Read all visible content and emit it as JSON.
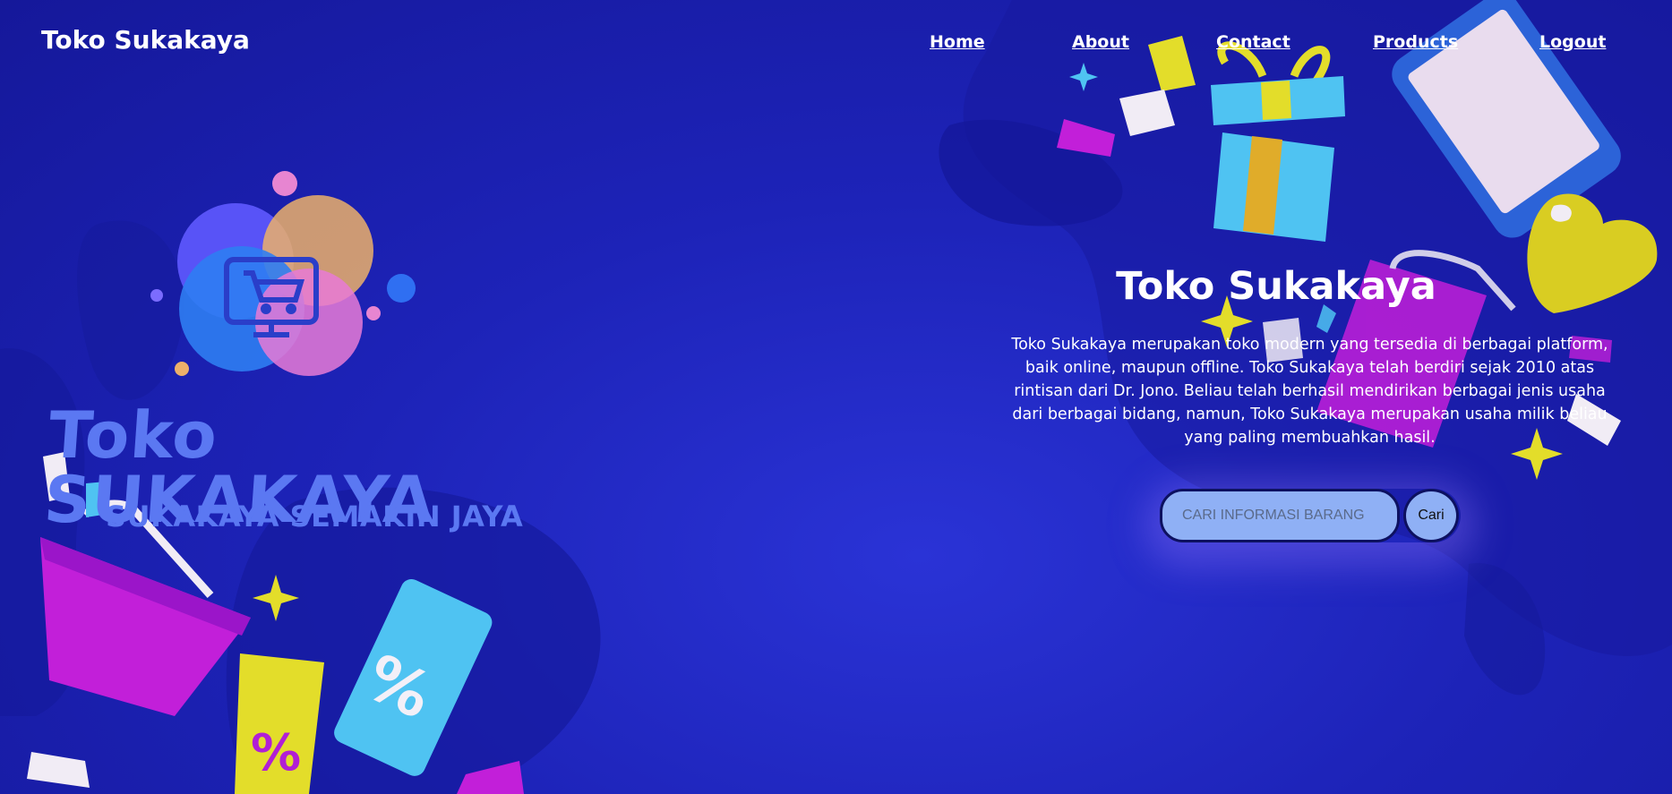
{
  "header": {
    "brand": "Toko Sukakaya",
    "nav": {
      "home": "Home",
      "about": "About",
      "contact": "Contact",
      "products": "Products",
      "logout": "Logout"
    }
  },
  "logo": {
    "title": "Toko SUKAKAYA",
    "tagline": "SUKAKAYA SEMAKIN JAYA"
  },
  "hero": {
    "title": "Toko Sukakaya",
    "description": "Toko Sukakaya merupakan toko modern yang tersedia di berbagai platform, baik online, maupun offline. Toko Sukakaya telah berdiri sejak 2010 atas rintisan dari Dr. Jono. Beliau telah berhasil mendirikan berbagai jenis usaha dari berbagai bidang, namun, Toko Sukakaya merupakan usaha milik beliau yang paling membuahkan hasil."
  },
  "search": {
    "placeholder": "CARI INFORMASI BARANG",
    "button_label": "Cari"
  },
  "icons": [
    "shopping-cart-icon",
    "percent-icon",
    "gift-icon",
    "smartphone-icon",
    "heart-icon",
    "shopping-bag-icon",
    "sparkle-icon"
  ],
  "colors": {
    "background": "#1d23b8",
    "accent_yellow": "#e3dd2a",
    "accent_magenta": "#c21fd9",
    "accent_cyan": "#4fc3f2",
    "input_bg": "#8fb0f5"
  }
}
